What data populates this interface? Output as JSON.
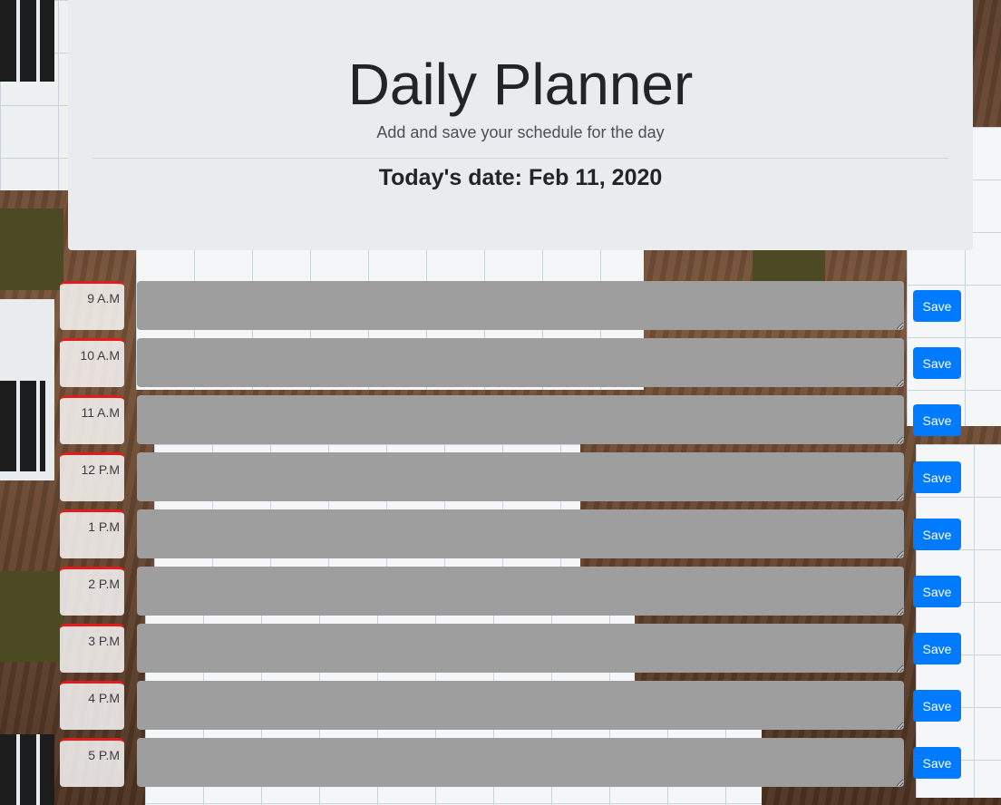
{
  "header": {
    "title": "Daily Planner",
    "subtitle": "Add and save your schedule for the day",
    "date_label": "Today's date:",
    "date_value": "Feb 11, 2020"
  },
  "rows": [
    {
      "hour": "9 A.M",
      "task": "",
      "save_label": "Save"
    },
    {
      "hour": "10 A.M",
      "task": "",
      "save_label": "Save"
    },
    {
      "hour": "11 A.M",
      "task": "",
      "save_label": "Save"
    },
    {
      "hour": "12 P.M",
      "task": "",
      "save_label": "Save"
    },
    {
      "hour": "1 P.M",
      "task": "",
      "save_label": "Save"
    },
    {
      "hour": "2 P.M",
      "task": "",
      "save_label": "Save"
    },
    {
      "hour": "3 P.M",
      "task": "",
      "save_label": "Save"
    },
    {
      "hour": "4 P.M",
      "task": "",
      "save_label": "Save"
    },
    {
      "hour": "5 P.M",
      "task": "",
      "save_label": "Save"
    }
  ],
  "colors": {
    "header_bg": "#e9ecef",
    "task_bg": "#9e9e9e",
    "save_button": "#007bff",
    "hour_border": "#e31b1b"
  }
}
